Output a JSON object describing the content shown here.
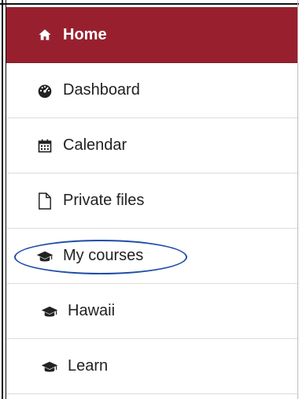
{
  "nav": {
    "items": [
      {
        "label": "Home",
        "icon": "home-icon",
        "active": true
      },
      {
        "label": "Dashboard",
        "icon": "dashboard-icon"
      },
      {
        "label": "Calendar",
        "icon": "calendar-icon"
      },
      {
        "label": "Private files",
        "icon": "file-icon"
      },
      {
        "label": "My courses",
        "icon": "graduation-cap-icon",
        "highlighted": true
      },
      {
        "label": "Hawaii",
        "icon": "graduation-cap-icon"
      },
      {
        "label": "Learn",
        "icon": "graduation-cap-icon"
      }
    ]
  },
  "colors": {
    "active_bg": "#98202e",
    "active_text": "#ffffff",
    "text": "#222222",
    "divider": "#dcdcdc",
    "highlight_ring": "#1f4ea8"
  }
}
